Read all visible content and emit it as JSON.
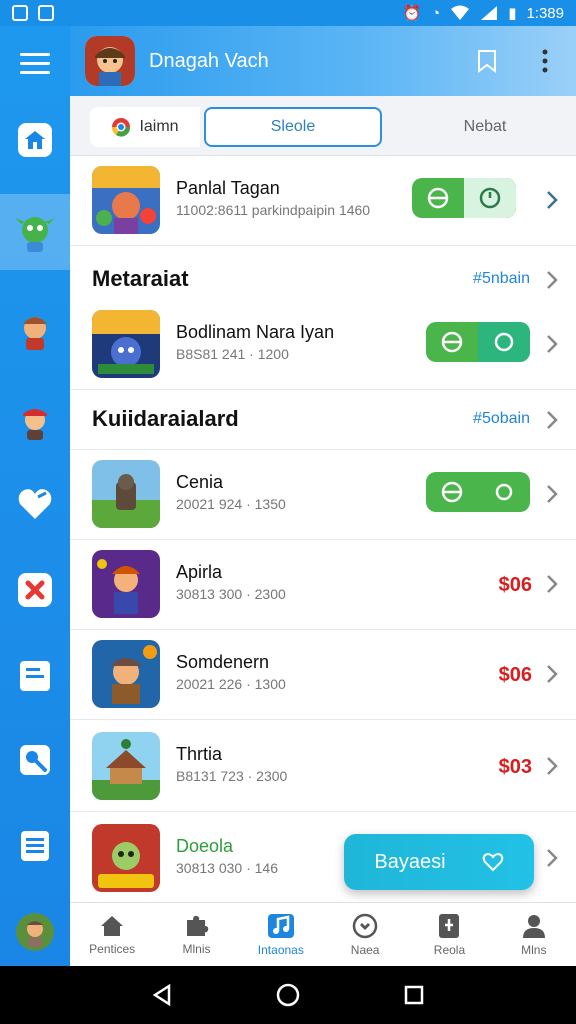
{
  "status_bar": {
    "time": "1:389"
  },
  "header": {
    "title": "Dnagah Vach"
  },
  "tabs": [
    {
      "label": "Iaimn"
    },
    {
      "label": "Sleole"
    },
    {
      "label": "Nebat"
    }
  ],
  "featured": {
    "title": "Panlal Tagan",
    "subtitle": "11002:8611 parkindpaipin 1460"
  },
  "sections": [
    {
      "title": "Metaraiat",
      "link": "#5nbain",
      "items": [
        {
          "title": "Bodlinam Nara Iyan",
          "subtitle": "B8S81 241 · 1200"
        }
      ]
    },
    {
      "title": "Kuiidaraialard",
      "link": "#5obain",
      "items": [
        {
          "title": "Cenia",
          "subtitle": "20021 924 · 1350"
        },
        {
          "title": "Apirla",
          "subtitle": "30813 300 · 2300",
          "price": "$06"
        },
        {
          "title": "Somdenern",
          "subtitle": "20021 226 · 1300",
          "price": "$06"
        },
        {
          "title": "Thrtia",
          "subtitle": "B8131 723 · 2300",
          "price": "$03"
        },
        {
          "title": "Doeola",
          "subtitle": "30813 030 · 146"
        }
      ]
    }
  ],
  "fab": {
    "label": "Bayaesi"
  },
  "bottom_nav": [
    {
      "label": "Pentices",
      "icon": "house-icon"
    },
    {
      "label": "Mlnis",
      "icon": "puzzle-icon"
    },
    {
      "label": "Intaonas",
      "icon": "music-icon"
    },
    {
      "label": "Naea",
      "icon": "heart-circle-icon"
    },
    {
      "label": "Reola",
      "icon": "device-icon"
    },
    {
      "label": "Mlns",
      "icon": "user-icon"
    }
  ],
  "colors": {
    "primary": "#1a8fe8",
    "accent_green": "#4ab54a",
    "price_red": "#d81e1e",
    "fab": "#22c1e6"
  }
}
